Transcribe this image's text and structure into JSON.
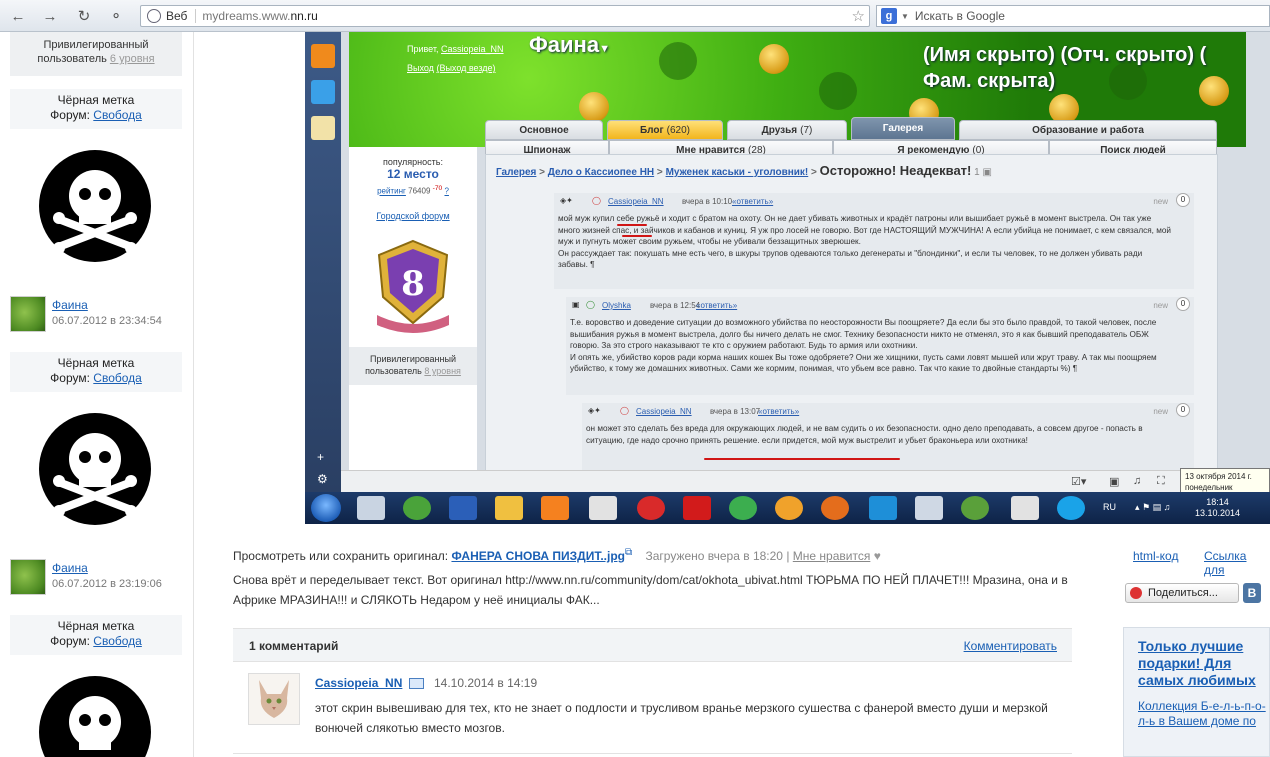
{
  "browser": {
    "omni_label": "Веб",
    "url_prefix": "mydreams.www.",
    "url_host": "nn.ru",
    "search_placeholder": "Искать в Google"
  },
  "sidebar": {
    "priv_line1": "Привилегированный",
    "priv_line2": "пользователь",
    "priv_level": "6 уровня",
    "blocks": [
      {
        "title": "Чёрная метка",
        "forum_label": "Форум:",
        "forum": "Свобода"
      },
      {
        "title": "Чёрная метка",
        "forum_label": "Форум:",
        "forum": "Свобода"
      },
      {
        "title": "Чёрная метка",
        "forum_label": "Форум:",
        "forum": "Свобода"
      }
    ],
    "users": [
      {
        "name": "Фаина",
        "date": "06.07.2012 в 23:34:54"
      },
      {
        "name": "Фаина",
        "date": "06.07.2012 в 23:19:06"
      }
    ]
  },
  "screenshot": {
    "greet": "Привет,",
    "greet_user": "Cassiopeia_NN",
    "exit": "Выход",
    "exit_all": "(Выход везде)",
    "profile_name": "Фаина",
    "hidden_text_1": "(Имя скрыто) (Отч. скрыто) (",
    "hidden_text_2": "Фам. скрыта)",
    "tabs_row1": [
      {
        "label": "Основное",
        "count": ""
      },
      {
        "label": "Блог",
        "count": "(620)"
      },
      {
        "label": "Друзья",
        "count": "(7)"
      },
      {
        "label": "Галерея",
        "count": ""
      },
      {
        "label": "Образование и работа",
        "count": ""
      }
    ],
    "tabs_row2": [
      {
        "label": "Шпионаж",
        "count": ""
      },
      {
        "label": "Мне нравится",
        "count": "(28)"
      },
      {
        "label": "Я рекомендую",
        "count": "(0)"
      },
      {
        "label": "Поиск людей",
        "count": ""
      }
    ],
    "popularity_label": "популярность:",
    "popularity_place": "12 место",
    "rating_label": "рейтинг",
    "rating_value": "76409",
    "rating_delta": "-70",
    "rating_q": "?",
    "city_forum": "Городской форум",
    "badge_number": "8",
    "priv_line1": "Привилегированный",
    "priv_line2": "пользователь",
    "priv_level": "8 уровня",
    "crumbs": [
      "Галерея",
      "Дело о Кассиопее НН",
      "Муженек каськи - уголовник!"
    ],
    "crumb_current": "Осторожно! Неадекват!",
    "crumb_count": "1",
    "comments": [
      {
        "user": "Cassiopeia_NN",
        "time": "вчера в 10:10",
        "reply": "«ответить»",
        "new": "new",
        "score": "0",
        "text": "мой муж купил себе ружьё и ходит с братом на охоту. Он не дает убивать животных и крадёт патроны или вышибает ружьё в момент выстрела. Он так уже много жизней спас, и зайчиков и кабанов и куниц. Я уж про лосей не говорю. Вот где НАСТОЯЩИЙ МУЖЧИНА! А если убийца не понимает, с кем связался, мой муж и пугнуть может своим ружьем, чтобы не убивали беззащитных зверюшек.",
        "text2": "Он рассуждает так: покушать мне есть чего, в шкуры трупов одеваются только дегенераты и \"блондинки\", и если ты человек, то не должен убивать ради забавы. ¶"
      },
      {
        "user": "Olyshka",
        "time": "вчера в 12:54",
        "reply": "«ответить»",
        "new": "new",
        "score": "0",
        "text": "Т.е. воровство и доведение ситуации до возможного убийства по неосторожности Вы поощряете? Да если бы это было правдой, то такой человек, после вышибания ружья в момент выстрела, долго бы ничего делать не смог. Технику безопасности никто не отменял, это я как бывший преподаватель ОБЖ говорю. За это строго наказывают те кто с оружием работают. Будь то армия или охотники.",
        "text2": "И опять же, убийство коров ради корма наших кошек Вы тоже одобряете? Они же хищники, пусть сами ловят мышей или жрут траву. А так мы поощряем убийство, к тому же домашних животных. Сами же кормим, понимая, что убьем все равно. Так что какие то двойные стандарты %) ¶"
      },
      {
        "user": "Cassiopeia_NN",
        "time": "вчера в 13:07",
        "reply": "«ответить»",
        "new": "new",
        "score": "0",
        "text": "он может это сделать без вреда для окружающих людей, и не вам судить о их безопасности. одно дело преподавать, а совсем другое - попасть в ситуацию, где надо срочно принять решение. если придется, мой муж выстрелит и убьет браконьера или охотника!",
        "text2": ""
      }
    ],
    "tooltip_line1": "13 октября 2014 г.",
    "tooltip_line2": "понедельник",
    "lang": "RU",
    "clock_time": "18:14",
    "clock_date": "13.10.2014"
  },
  "photo": {
    "orig_label": "Просмотреть или сохранить оригинал:",
    "orig_file": "ФАНЕРА СНОВА ПИЗДИТ..jpg",
    "uploaded": "Загружено вчера в 18:20",
    "separator": "|",
    "like": "Мне нравится",
    "description": "Снова врёт и переделывает текст. Вот оригинал http://www.nn.ru/community/dom/cat/okhota_ubivat.html ТЮРЬМА ПО НЕЙ ПЛАЧЕТ!!! Мразина, она и в Африке МРАЗИНА!!! и СЛЯКОТЬ Недаром у неё инициалы ФАК...",
    "html_code": "html-код",
    "link_to": "Ссылка для",
    "share": "Поделиться...",
    "vk": "В"
  },
  "ad": {
    "title": "Только лучшие подарки! Для самых любимых",
    "text_1": "Коллекция Б-е-л-ь-п-о-",
    "text_2": "л-ь в Вашем доме по"
  },
  "comments_block": {
    "count_label": "1 комментарий",
    "comment_link": "Комментировать",
    "items": [
      {
        "user": "Cassiopeia_NN",
        "date": "14.10.2014 в 14:19",
        "text": "этот скрин вывешиваю для тех, кто не знает о подлости и трусливом вранье мерзкого сушества с фанерой вместо души и мерзкой вонючей слякотью вместо мозгов."
      }
    ]
  },
  "colors": {
    "link": "#1a5fb4",
    "banner_green": "#3fae12",
    "blog_tab": "#f2b51c",
    "active_tab": "#5d7591",
    "underline_red": "#d01515"
  }
}
